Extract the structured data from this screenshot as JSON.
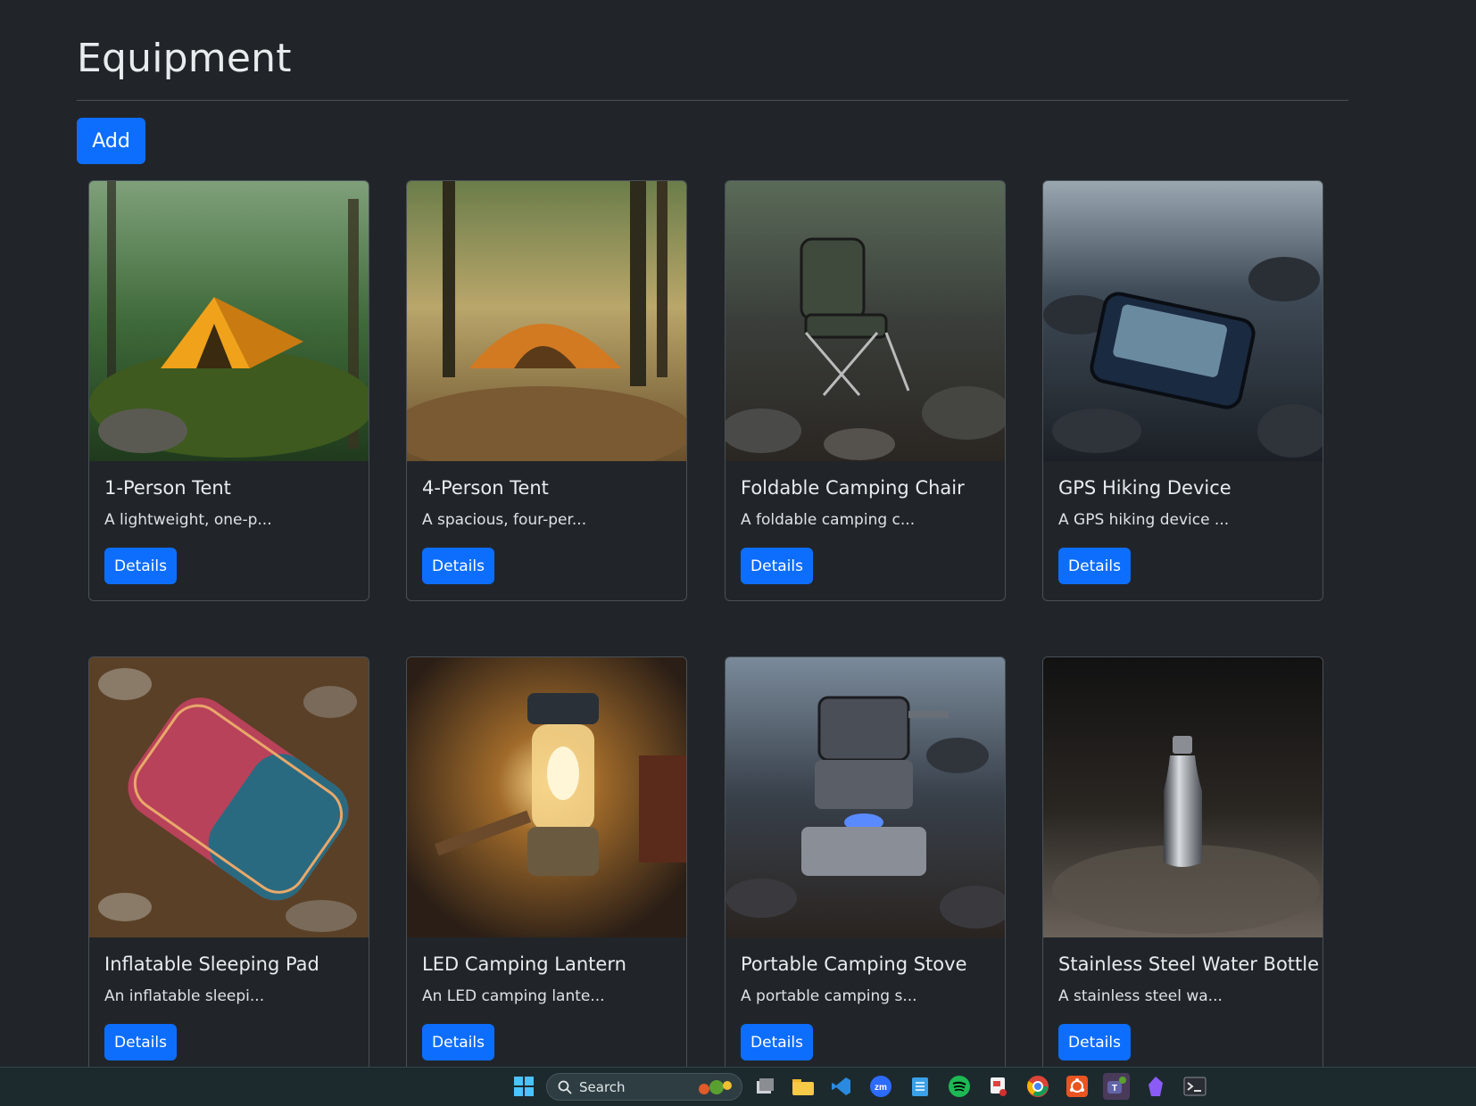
{
  "page": {
    "title": "Equipment",
    "add_label": "Add"
  },
  "items": [
    {
      "title": "1-Person Tent",
      "description": "A lightweight, one-p...",
      "button": "Details",
      "image": "tent-in-forest"
    },
    {
      "title": "4-Person Tent",
      "description": "A spacious, four-per...",
      "button": "Details",
      "image": "large-tent-campsite"
    },
    {
      "title": "Foldable Camping Chair",
      "description": "A foldable camping c...",
      "button": "Details",
      "image": "camping-chair-on-rocks"
    },
    {
      "title": "GPS Hiking Device",
      "description": "A GPS hiking device ...",
      "button": "Details",
      "image": "gps-device-on-rocks"
    },
    {
      "title": "Inflatable Sleeping Pad",
      "description": "An inflatable sleepi...",
      "button": "Details",
      "image": "sleeping-pad-on-ground"
    },
    {
      "title": "LED Camping Lantern",
      "description": "An LED camping lante...",
      "button": "Details",
      "image": "lit-lantern"
    },
    {
      "title": "Portable Camping Stove",
      "description": "A portable camping s...",
      "button": "Details",
      "image": "stove-with-pot"
    },
    {
      "title": "Stainless Steel Water Bottle",
      "description": "A stainless steel wa...",
      "button": "Details",
      "image": "steel-bottle"
    }
  ],
  "taskbar": {
    "search_label": "Search",
    "icons": [
      "windows-start-icon",
      "search-icon",
      "task-view-icon",
      "file-explorer-icon",
      "vscode-icon",
      "zoom-icon",
      "notepad-icon",
      "spotify-icon",
      "snipping-tool-icon",
      "chrome-icon",
      "ubuntu-icon",
      "teams-icon",
      "obsidian-icon",
      "terminal-icon"
    ]
  },
  "colors": {
    "background": "#212529",
    "primary": "#0d6efd",
    "border": "#495057"
  }
}
